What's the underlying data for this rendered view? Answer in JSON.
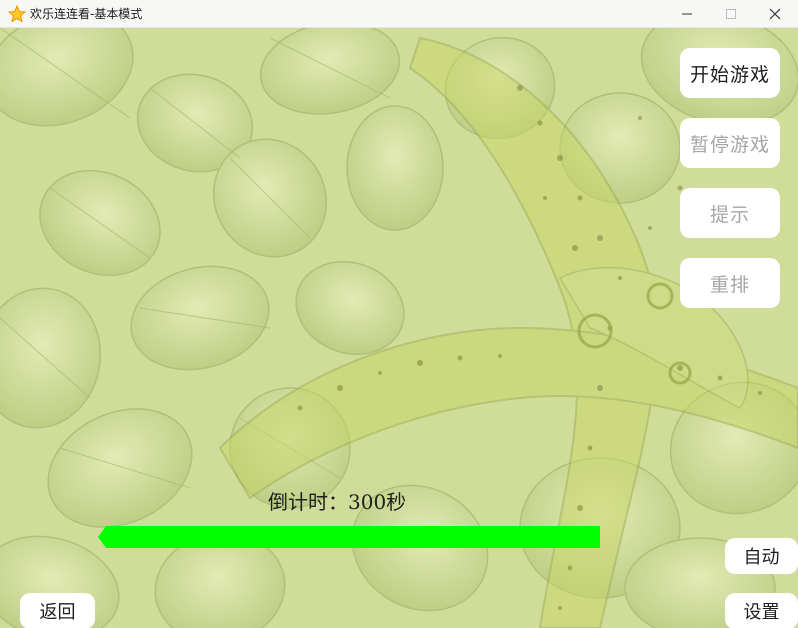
{
  "window": {
    "title": "欢乐连连看-基本模式",
    "icon": "star-icon",
    "controls": [
      "minimize-icon",
      "maximize-icon",
      "close-icon"
    ]
  },
  "side_buttons": {
    "start": "开始游戏",
    "pause": "暂停游戏",
    "hint": "提示",
    "reshuffle": "重排"
  },
  "timer": {
    "label": "倒计时：300秒",
    "remaining_fraction": 1.0
  },
  "bottom_buttons": {
    "auto": "自动",
    "settings": "设置",
    "back": "返回"
  },
  "colors": {
    "progress": "#00ff00",
    "enabled_text": "#1e1e1e",
    "disabled_text": "#a6a6a6"
  }
}
